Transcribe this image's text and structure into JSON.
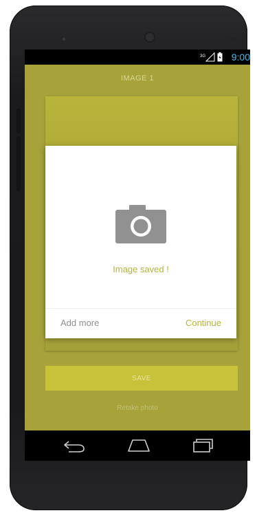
{
  "status_bar": {
    "time": "9:00",
    "signal_label": "3G",
    "network_icon": "signal-icon",
    "battery_icon": "battery-icon"
  },
  "app": {
    "title": "IMAGE 1",
    "save_label": "SAVE",
    "retake_label": "Retake photo"
  },
  "dialog": {
    "icon": "camera-icon",
    "message": "Image saved !",
    "actions": {
      "add_more": "Add more",
      "continue": "Continue"
    }
  },
  "nav": {
    "back_icon": "back-icon",
    "home_icon": "home-icon",
    "recents_icon": "recents-icon"
  },
  "colors": {
    "screen_background": "#a7a33a",
    "accent": "#b6b33a",
    "status_text": "#49b9e8",
    "dialog_background": "#ffffff"
  }
}
